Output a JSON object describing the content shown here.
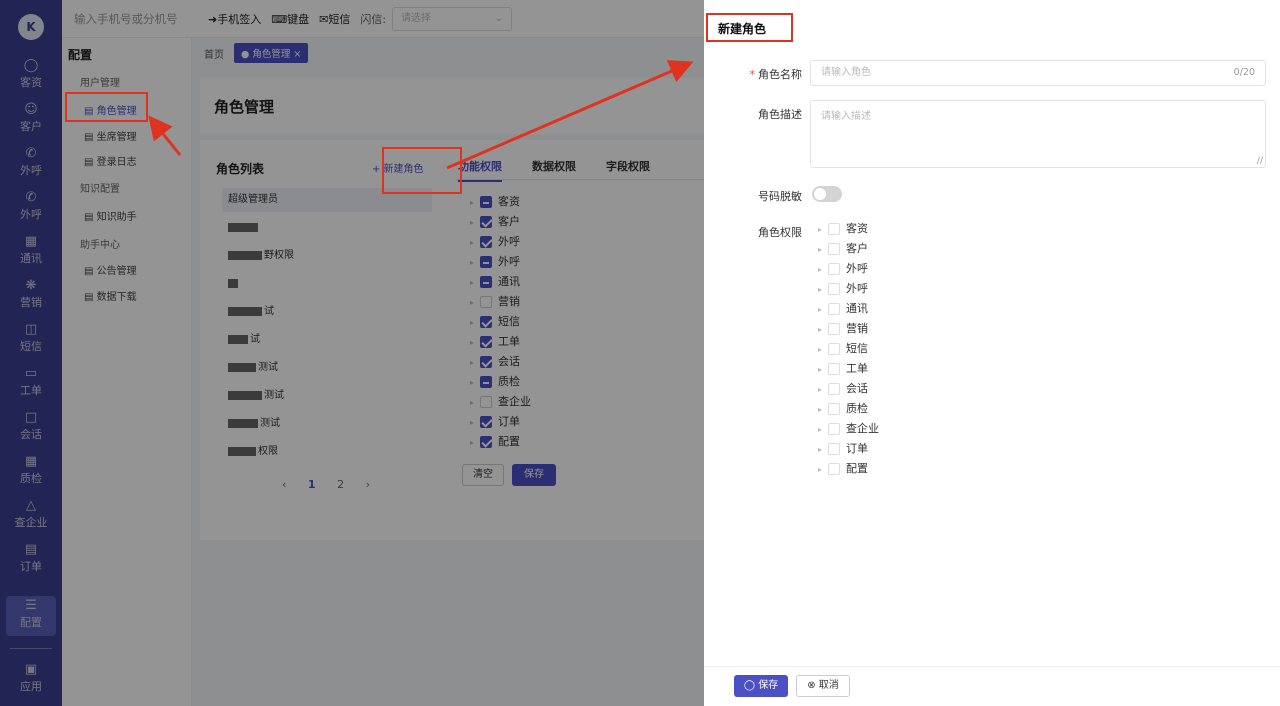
{
  "topbar": {
    "phone_placeholder": "输入手机号或分机号",
    "phone_login": "手机签入",
    "keyboard": "键盘",
    "sms": "短信",
    "flash_label": "闪信:",
    "flash_placeholder": "请选择"
  },
  "rail": {
    "items": [
      {
        "label": "客资",
        "icon": "people-icon"
      },
      {
        "label": "客户",
        "icon": "person-icon"
      },
      {
        "label": "外呼",
        "icon": "phone-out-icon"
      },
      {
        "label": "外呼",
        "icon": "phone-out-icon"
      },
      {
        "label": "通讯",
        "icon": "contact-book-icon"
      },
      {
        "label": "营销",
        "icon": "marketing-icon"
      },
      {
        "label": "短信",
        "icon": "sms-icon"
      },
      {
        "label": "工单",
        "icon": "clipboard-icon"
      },
      {
        "label": "会话",
        "icon": "chat-icon"
      },
      {
        "label": "质检",
        "icon": "inspect-icon"
      },
      {
        "label": "查企业",
        "icon": "building-icon"
      },
      {
        "label": "订单",
        "icon": "order-icon"
      },
      {
        "label": "配置",
        "icon": "settings-icon"
      },
      {
        "label": "应用",
        "icon": "app-icon"
      }
    ]
  },
  "menu": {
    "title": "配置",
    "group_user": "用户管理",
    "item_role": "角色管理",
    "item_seat": "坐席管理",
    "item_log": "登录日志",
    "group_knowledge": "知识配置",
    "item_assistant": "知识助手",
    "group_help": "助手中心",
    "item_notice": "公告管理",
    "item_download": "数据下载"
  },
  "breadcrumb": {
    "home": "首页",
    "current": "角色管理"
  },
  "page": {
    "title": "角色管理"
  },
  "roles": {
    "title": "角色列表",
    "new_button": "+ 新建角色",
    "items": [
      "超级管理员",
      "",
      "野权限",
      "",
      "试",
      "试",
      "测试",
      "测试",
      "测试",
      "权限"
    ],
    "pages": [
      "1",
      "2"
    ]
  },
  "perm_tabs": [
    "功能权限",
    "数据权限",
    "字段权限"
  ],
  "perm_modules": [
    "客资",
    "客户",
    "外呼",
    "外呼",
    "通讯",
    "营销",
    "短信",
    "工单",
    "会话",
    "质检",
    "查企业",
    "订单",
    "配置"
  ],
  "perm_buttons": {
    "clear": "清空",
    "save": "保存"
  },
  "drawer": {
    "title": "新建角色",
    "name_label": "角色名称",
    "name_placeholder": "请输入角色",
    "name_count": "0/20",
    "desc_label": "角色描述",
    "desc_placeholder": "请输入描述",
    "mask_label": "号码脱敏",
    "perm_label": "角色权限",
    "save": "保存",
    "cancel": "取消"
  },
  "colors": {
    "accent": "#4b50c4",
    "rail": "#3b3f8f",
    "annotation": "#e0331f"
  }
}
